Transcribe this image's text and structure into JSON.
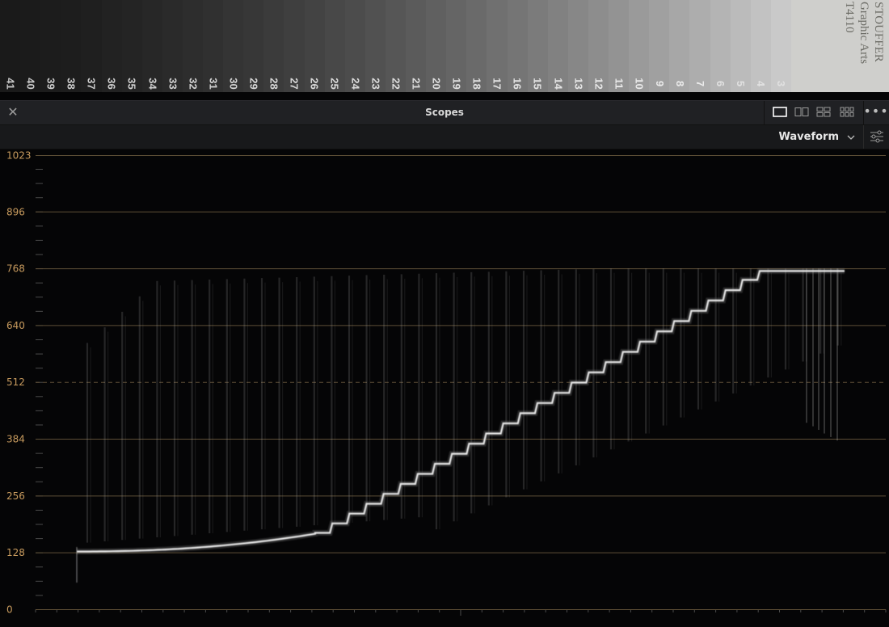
{
  "strip": {
    "patch_numbers": [
      "41",
      "40",
      "39",
      "38",
      "37",
      "36",
      "35",
      "34",
      "33",
      "32",
      "31",
      "30",
      "29",
      "28",
      "27",
      "26",
      "25",
      "24",
      "23",
      "22",
      "21",
      "20",
      "19",
      "18",
      "17",
      "16",
      "15",
      "14",
      "13",
      "12",
      "11",
      "10",
      "9",
      "8",
      "7",
      "6",
      "5",
      "4",
      "3"
    ],
    "brand_lines": [
      "STOUFFER",
      "Graphic Arts",
      "T4110"
    ]
  },
  "panel": {
    "title": "Scopes",
    "close_icon": "close-icon",
    "layout_buttons": [
      "single-layout-icon",
      "dual-layout-icon",
      "quad-layout-icon",
      "six-up-layout-icon"
    ],
    "options_glyph": "•••"
  },
  "toolbar": {
    "scope_type": "Waveform",
    "settings_icon": "sliders-icon"
  },
  "scope": {
    "y_ticks": [
      "0",
      "128",
      "256",
      "384",
      "512",
      "640",
      "768",
      "896",
      "1023"
    ],
    "y_range": [
      0,
      1023
    ],
    "dashed_line_at": 512,
    "colors": {
      "grid": "#5e4f36",
      "label": "#c89b5e",
      "trace": "#e6e6e6"
    }
  }
}
